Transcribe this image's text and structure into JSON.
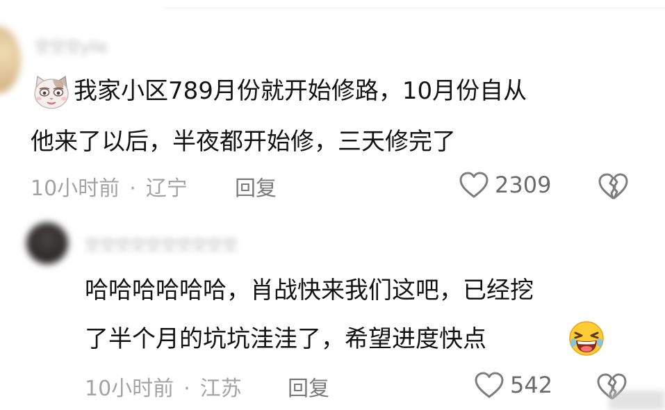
{
  "comments": [
    {
      "username": "空空空ylle",
      "emoji": "cat-face-emoji",
      "text_line1": "我家小区789月份就开始修路，10月份自从",
      "text_line2": "他来了以后，半夜都开始修，三天修完了",
      "time": "10小时前",
      "separator": "·",
      "location": "辽宁",
      "reply_label": "回复",
      "likes": "2309"
    },
    {
      "username": "空空空空空空空空空空",
      "emoji": "laughing-face-emoji",
      "text_line1": "哈哈哈哈哈哈，肖战快来我们这吧，已经挖",
      "text_line2": "了半个月的坑坑洼洼了，希望进度快点",
      "time": "10小时前",
      "separator": "·",
      "location": "江苏",
      "reply_label": "回复",
      "likes": "542"
    }
  ],
  "colors": {
    "text": "#121212",
    "meta": "#a3a3a3",
    "reply": "#7a7a7a",
    "icon": "#7d7d7d",
    "background": "#ffffff"
  }
}
